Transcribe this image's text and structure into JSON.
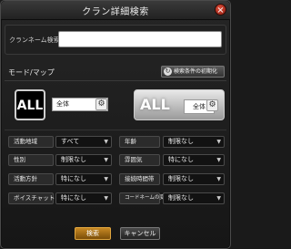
{
  "dialog": {
    "title": "クラン詳細検索"
  },
  "clan_name": {
    "label": "クランネーム検索",
    "value": ""
  },
  "mode_map": {
    "label": "モード/マップ",
    "reset_label": "検索条件の初期化",
    "badge_text": "ALL",
    "mode_value": "全体",
    "map_value": "全体"
  },
  "filters": [
    {
      "label": "活動地域",
      "value": "すべて"
    },
    {
      "label": "年齢",
      "value": "制限なし"
    },
    {
      "label": "性別",
      "value": "制限なし"
    },
    {
      "label": "雰囲気",
      "value": "特になし"
    },
    {
      "label": "活動方針",
      "value": "特になし"
    },
    {
      "label": "接続時間帯",
      "value": "制限なし"
    },
    {
      "label": "ボイスチャット",
      "value": "特になし"
    },
    {
      "label": "コードネームの変更",
      "value": "制限なし"
    }
  ],
  "footer": {
    "search_label": "検索",
    "cancel_label": "キャンセル"
  }
}
